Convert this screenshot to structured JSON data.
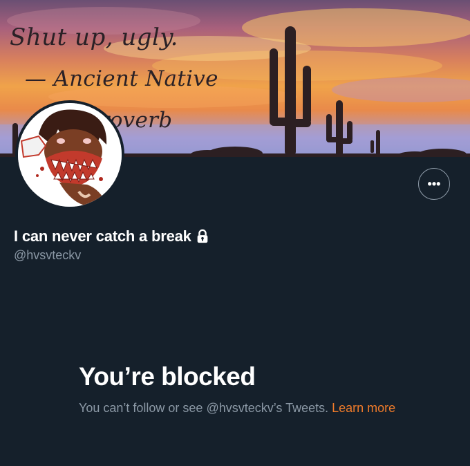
{
  "banner": {
    "line1": "Shut up, ugly.",
    "line2": "— Ancient Native",
    "line3": "n Proverb"
  },
  "profile": {
    "display_name": "I can never catch a break",
    "handle": "@hvsvteckv",
    "more_label": "•••",
    "lock_icon": "lock-icon"
  },
  "blocked": {
    "title": "You’re blocked",
    "message": "You can’t follow or see @hvsvteckv’s Tweets.",
    "learn_more": "Learn more"
  },
  "colors": {
    "background": "#15202b",
    "secondary_text": "#8b98a5",
    "link": "#f07b2a"
  }
}
